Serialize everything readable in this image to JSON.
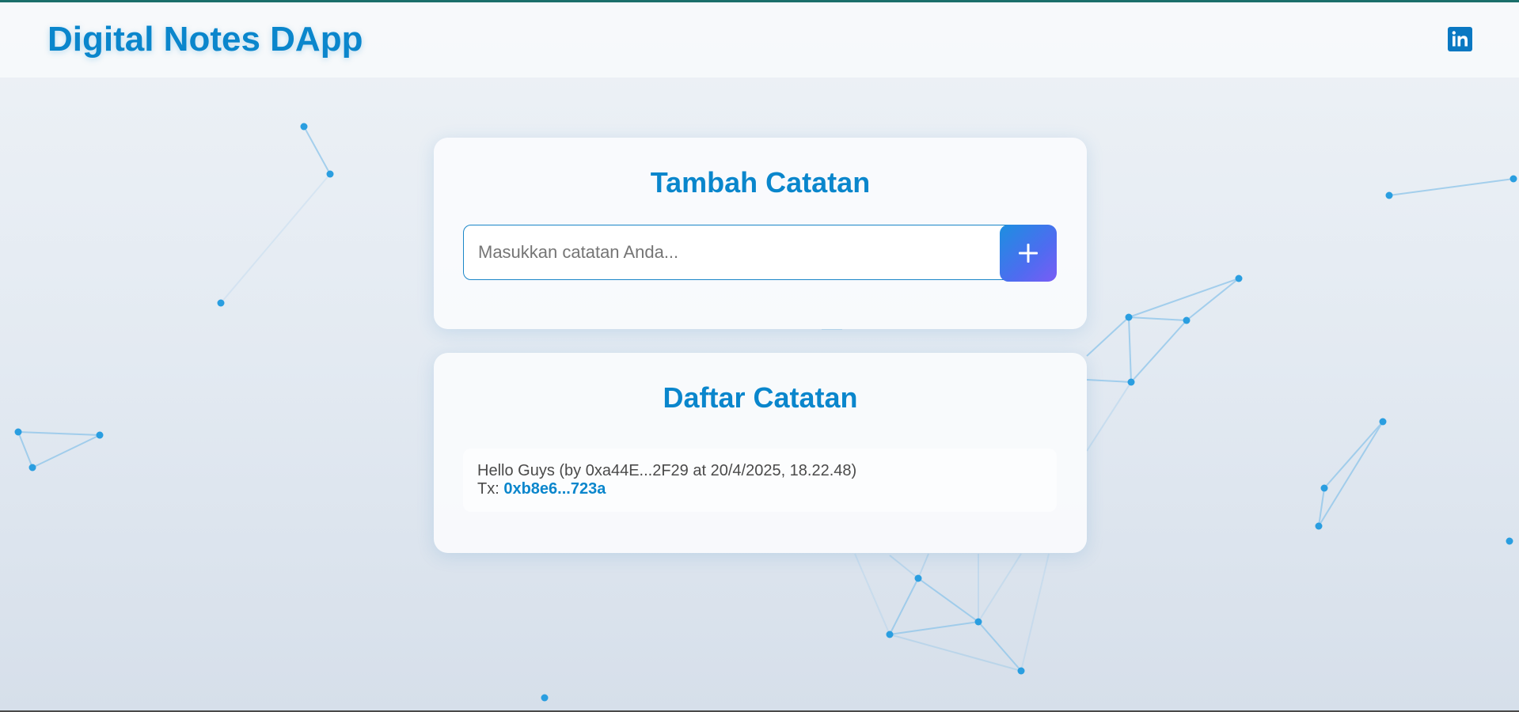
{
  "header": {
    "title": "Digital Notes DApp",
    "linkedin_icon": "linkedin-icon"
  },
  "add_note": {
    "title": "Tambah Catatan",
    "input_placeholder": "Masukkan catatan Anda...",
    "input_value": "",
    "add_button_icon": "plus-icon"
  },
  "note_list": {
    "title": "Daftar Catatan",
    "notes": [
      {
        "text": "Hello Guys (by 0xa44E...2F29 at 20/4/2025, 18.22.48)",
        "tx_label": "Tx: ",
        "tx_hash": "0xb8e6...723a"
      }
    ]
  },
  "colors": {
    "accent": "#0a86cc",
    "top_strip": "#1a6f6a",
    "button_gradient_start": "#1c8fe0",
    "button_gradient_end": "#7a5cf5",
    "network_node": "#2a9ee0",
    "network_line": "#8cc4ea"
  }
}
